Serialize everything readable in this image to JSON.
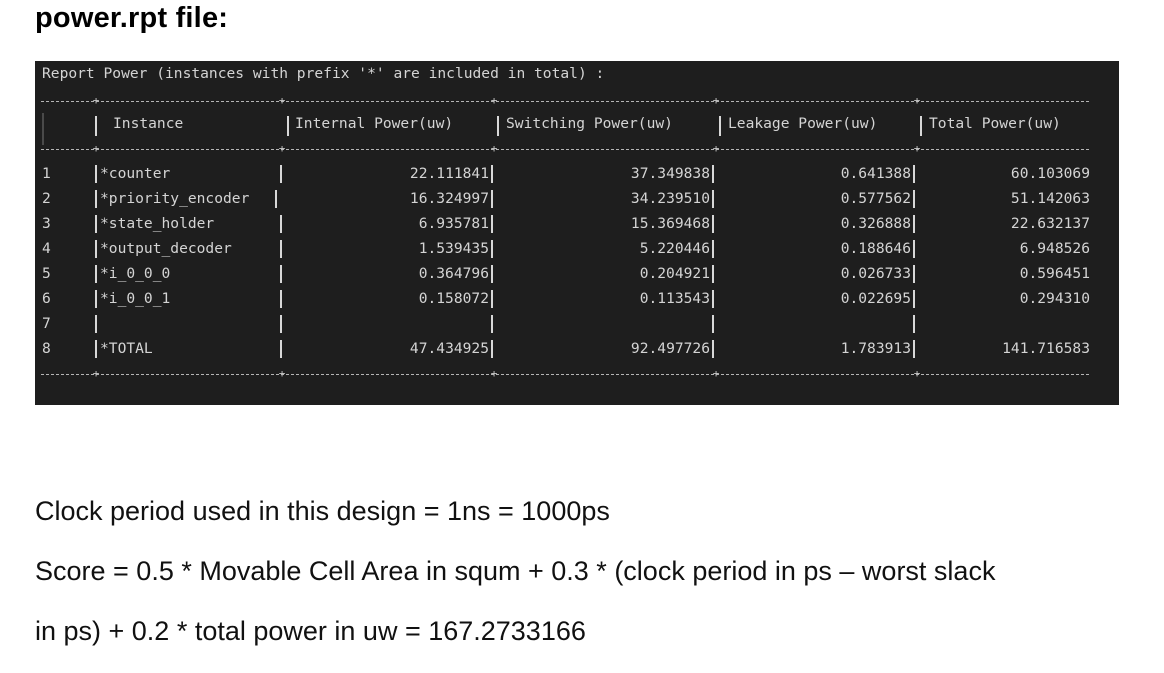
{
  "heading": "power.rpt file:",
  "report": {
    "title": "Report Power (instances with prefix '*' are included in total) :",
    "headers": {
      "instance": "Instance",
      "internal": "Internal Power(uw)",
      "switching": "Switching Power(uw)",
      "leakage": "Leakage Power(uw)",
      "total": "Total Power(uw)"
    },
    "rows": [
      {
        "line": "1",
        "instance": "*counter",
        "internal": "22.111841",
        "switching": "37.349838",
        "leakage": "0.641388",
        "total": "60.103069"
      },
      {
        "line": "2",
        "instance": "*priority_encoder",
        "internal": "16.324997",
        "switching": "34.239510",
        "leakage": "0.577562",
        "total": "51.142063"
      },
      {
        "line": "3",
        "instance": "*state_holder",
        "internal": "6.935781",
        "switching": "15.369468",
        "leakage": "0.326888",
        "total": "22.632137"
      },
      {
        "line": "4",
        "instance": "*output_decoder",
        "internal": "1.539435",
        "switching": "5.220446",
        "leakage": "0.188646",
        "total": "6.948526"
      },
      {
        "line": "5",
        "instance": "*i_0_0_0",
        "internal": "0.364796",
        "switching": "0.204921",
        "leakage": "0.026733",
        "total": "0.596451"
      },
      {
        "line": "6",
        "instance": "*i_0_0_1",
        "internal": "0.158072",
        "switching": "0.113543",
        "leakage": "0.022695",
        "total": "0.294310"
      },
      {
        "line": "7",
        "instance": "",
        "internal": "",
        "switching": "",
        "leakage": "",
        "total": ""
      },
      {
        "line": "8",
        "instance": "*TOTAL",
        "internal": "47.434925",
        "switching": "92.497726",
        "leakage": "1.783913",
        "total": "141.716583"
      }
    ]
  },
  "text": {
    "clock_line": "Clock period used in this design = 1ns = 1000ps",
    "score_line1": "Score = 0.5 * Movable Cell Area in squm + 0.3 * (clock period in ps – worst slack",
    "score_line2": "in ps) + 0.2 * total power in uw = 167.2733166"
  }
}
